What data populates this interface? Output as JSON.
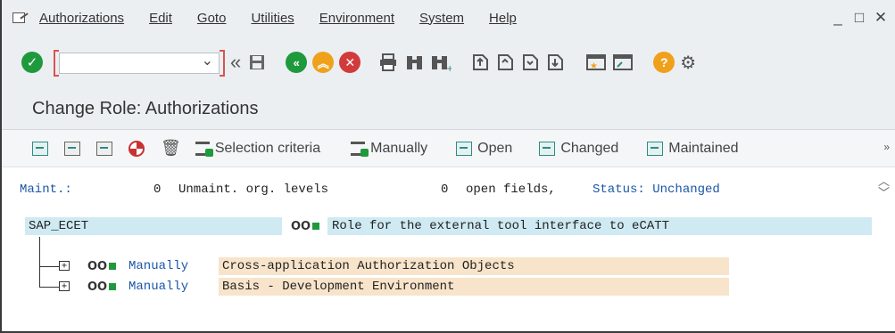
{
  "menubar": {
    "items": [
      {
        "label": "Authorizations"
      },
      {
        "label": "Edit"
      },
      {
        "label": "Goto"
      },
      {
        "label": "Utilities"
      },
      {
        "label": "Environment"
      },
      {
        "label": "System"
      },
      {
        "label": "Help"
      }
    ],
    "window_controls": {
      "minimize": "_",
      "maximize": "□",
      "close": "✕"
    }
  },
  "toolbar": {
    "command_field_value": "",
    "icons": [
      "enter-check-icon",
      "back-double-chevron-icon",
      "save-icon",
      "back-icon",
      "exit-icon",
      "cancel-icon",
      "print-icon",
      "find-icon",
      "find-next-icon",
      "first-page-icon",
      "previous-page-icon",
      "next-page-icon",
      "last-page-icon",
      "create-session-icon",
      "shortcut-icon",
      "help-icon",
      "settings-icon"
    ]
  },
  "title": "Change Role: Authorizations",
  "app_toolbar": {
    "selection_criteria": "Selection criteria",
    "manually": "Manually",
    "open": "Open",
    "changed": "Changed",
    "maintained": "Maintained",
    "more": "»"
  },
  "status_line": {
    "maint_label": "Maint.:",
    "unmaint_count": "0",
    "unmaint_label": "Unmaint. org. levels",
    "open_count": "0",
    "open_label": "open fields,",
    "status_label": "Status: Unchanged"
  },
  "tree": {
    "role_name": "SAP_ECET",
    "role_status": "OO",
    "role_description": "Role for the external tool interface to eCATT",
    "children": [
      {
        "status": "OO",
        "type": "Manually",
        "description": "Cross-application Authorization Objects"
      },
      {
        "status": "OO",
        "type": "Manually",
        "description": "Basis - Development Environment"
      }
    ]
  },
  "colors": {
    "accent_green": "#1e9a3c",
    "role_highlight": "#cfeaf3",
    "child_highlight": "#f8e4ca",
    "link_blue": "#1a56a8"
  }
}
